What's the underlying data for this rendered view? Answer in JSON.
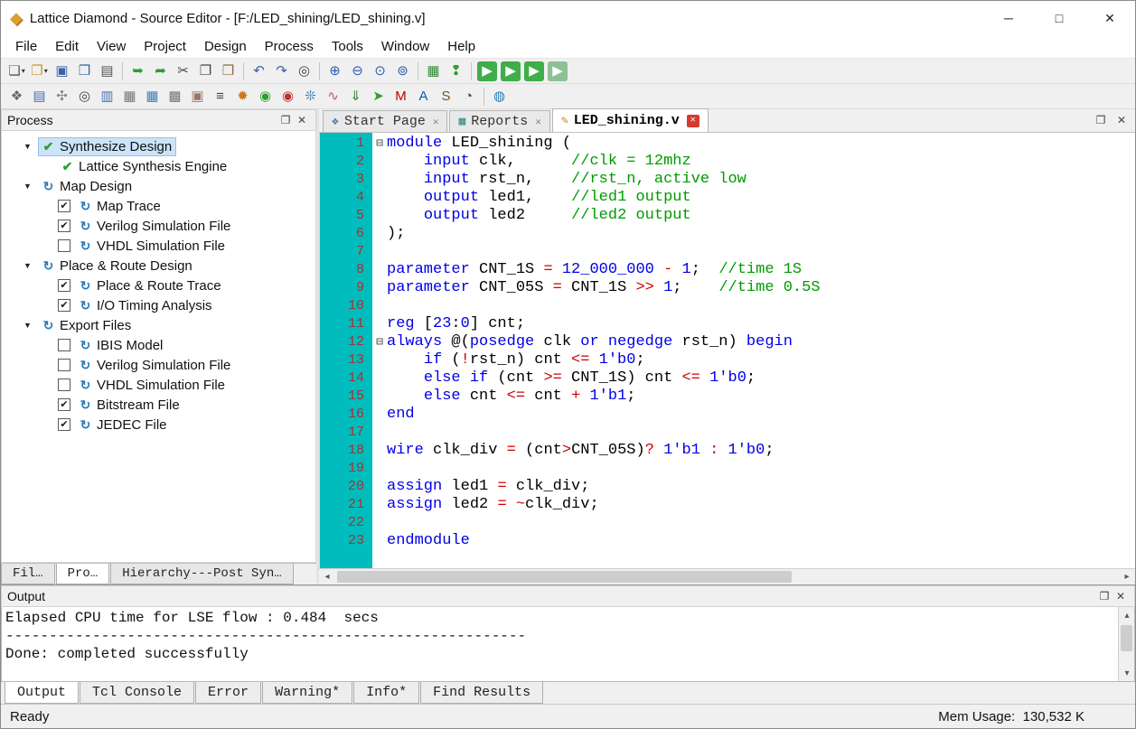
{
  "window": {
    "title": "Lattice Diamond - Source Editor - [F:/LED_shining/LED_shining.v]"
  },
  "icons": {
    "diamond": "◆",
    "minimize": "─",
    "maximize": "□",
    "close": "✕",
    "close_small": "✕",
    "float": "❐",
    "caret": "▾",
    "expander": "▼",
    "check": "✔",
    "check_green": "✔",
    "sync": "↻",
    "fold": "⊟",
    "arrow_left": "◂",
    "arrow_right": "▸",
    "arrow_up": "▴",
    "arrow_down": "▾",
    "start_page": "❖",
    "reports": "▦",
    "source": "✎"
  },
  "menu": {
    "items": [
      "File",
      "Edit",
      "View",
      "Project",
      "Design",
      "Process",
      "Tools",
      "Window",
      "Help"
    ]
  },
  "toolbar1": [
    {
      "name": "new-file",
      "glyph": "❏",
      "color": "#555555",
      "dropdown": true
    },
    {
      "name": "open-file",
      "glyph": "❐",
      "color": "#c8972c",
      "dropdown": true
    },
    {
      "name": "save",
      "glyph": "▣",
      "color": "#3a62a8"
    },
    {
      "name": "save-all",
      "glyph": "❒",
      "color": "#3a62a8"
    },
    {
      "name": "print",
      "glyph": "▤",
      "color": "#555555"
    },
    {
      "sep": true
    },
    {
      "name": "check-out",
      "glyph": "➥",
      "color": "#2f9e2f"
    },
    {
      "name": "check-in",
      "glyph": "➦",
      "color": "#2f9e2f"
    },
    {
      "name": "cut",
      "glyph": "✂",
      "color": "#444444"
    },
    {
      "name": "copy",
      "glyph": "❐",
      "color": "#444444"
    },
    {
      "name": "paste",
      "glyph": "❒",
      "color": "#8a6d3b"
    },
    {
      "sep": true
    },
    {
      "name": "undo",
      "glyph": "↶",
      "color": "#3a62a8"
    },
    {
      "name": "redo",
      "glyph": "↷",
      "color": "#3a62a8"
    },
    {
      "name": "find",
      "glyph": "◎",
      "color": "#444444"
    },
    {
      "sep": true
    },
    {
      "name": "zoom-in",
      "glyph": "⊕",
      "color": "#2a5db0"
    },
    {
      "name": "zoom-out",
      "glyph": "⊖",
      "color": "#2a5db0"
    },
    {
      "name": "zoom-fit",
      "glyph": "⊙",
      "color": "#2a5db0"
    },
    {
      "name": "zoom-selection",
      "glyph": "⊚",
      "color": "#2a5db0"
    },
    {
      "sep": true
    },
    {
      "name": "html-report",
      "glyph": "▦",
      "color": "#3a8a3a"
    },
    {
      "name": "message-console",
      "glyph": "❢",
      "color": "#2f9e2f"
    },
    {
      "sep": true
    },
    {
      "name": "run-synthesis",
      "glyph": "▶",
      "bg": "#3fae49"
    },
    {
      "name": "run-map",
      "glyph": "▶",
      "bg": "#3fae49"
    },
    {
      "name": "run-par",
      "glyph": "▶",
      "bg": "#3fae49"
    },
    {
      "name": "run-export",
      "glyph": "▶",
      "bg": "#8fbf94"
    }
  ],
  "toolbar2": [
    {
      "name": "new-project",
      "glyph": "❖",
      "color": "#666666"
    },
    {
      "name": "file-list",
      "glyph": "▤",
      "color": "#4a6fb5"
    },
    {
      "name": "process-flow",
      "glyph": "✣",
      "color": "#888888"
    },
    {
      "name": "find-in-files",
      "glyph": "◎",
      "color": "#444444"
    },
    {
      "name": "console",
      "glyph": "▥",
      "color": "#4a6fb5"
    },
    {
      "name": "message-window",
      "glyph": "▦",
      "color": "#777777"
    },
    {
      "name": "spreadsheet-view",
      "glyph": "▦",
      "color": "#3f7fbf"
    },
    {
      "name": "package-view",
      "glyph": "▩",
      "color": "#777777"
    },
    {
      "name": "device-view",
      "glyph": "▣",
      "color": "#997766"
    },
    {
      "name": "netlist-view",
      "glyph": "≡",
      "color": "#444444"
    },
    {
      "name": "ipexpress",
      "glyph": "✹",
      "color": "#c87820"
    },
    {
      "name": "reveal-inserter",
      "glyph": "◉",
      "color": "#2f9e2f"
    },
    {
      "name": "reveal-analyzer",
      "glyph": "◉",
      "color": "#c03030"
    },
    {
      "name": "clarity-designer",
      "glyph": "❊",
      "color": "#3f7fbf"
    },
    {
      "name": "power-calculator",
      "glyph": "∿",
      "color": "#b05090"
    },
    {
      "name": "programmer",
      "glyph": "⇓",
      "color": "#2f7f2f"
    },
    {
      "name": "run-manager",
      "glyph": "➤",
      "color": "#2f9e2f"
    },
    {
      "name": "modelsim",
      "glyph": "M",
      "color": "#c00000"
    },
    {
      "name": "active-hdl",
      "glyph": "A",
      "color": "#0060c0"
    },
    {
      "name": "synplify",
      "glyph": "S",
      "color": "#805020"
    },
    {
      "name": "timing-analyzer",
      "glyph": "◔",
      "color": "#444444"
    },
    {
      "sep": true
    },
    {
      "name": "help-globe",
      "glyph": "◍",
      "color": "#2a7ab5"
    }
  ],
  "process_panel": {
    "title": "Process",
    "tree": [
      {
        "level": 0,
        "expander": true,
        "icon": "check_green",
        "label": "Synthesize Design",
        "selected": true
      },
      {
        "level": 1,
        "icon": "check_green",
        "label": "Lattice Synthesis Engine"
      },
      {
        "level": 0,
        "expander": true,
        "icon": "sync",
        "label": "Map Design"
      },
      {
        "level": 1,
        "checkbox": "checked",
        "icon": "sync",
        "label": "Map Trace"
      },
      {
        "level": 1,
        "checkbox": "checked",
        "icon": "sync",
        "label": "Verilog Simulation File"
      },
      {
        "level": 1,
        "checkbox": "unchecked",
        "icon": "sync",
        "label": "VHDL Simulation File"
      },
      {
        "level": 0,
        "expander": true,
        "icon": "sync",
        "label": "Place & Route Design"
      },
      {
        "level": 1,
        "checkbox": "checked",
        "icon": "sync",
        "label": "Place & Route Trace"
      },
      {
        "level": 1,
        "checkbox": "checked",
        "icon": "sync",
        "label": "I/O Timing Analysis"
      },
      {
        "level": 0,
        "expander": true,
        "icon": "sync",
        "label": "Export Files"
      },
      {
        "level": 1,
        "checkbox": "unchecked",
        "icon": "sync",
        "label": "IBIS Model"
      },
      {
        "level": 1,
        "checkbox": "unchecked",
        "icon": "sync",
        "label": "Verilog Simulation File"
      },
      {
        "level": 1,
        "checkbox": "unchecked",
        "icon": "sync",
        "label": "VHDL Simulation File"
      },
      {
        "level": 1,
        "checkbox": "checked",
        "icon": "sync",
        "label": "Bitstream File"
      },
      {
        "level": 1,
        "checkbox": "checked",
        "icon": "sync",
        "label": "JEDEC File"
      }
    ],
    "tabs": [
      {
        "label": "Fil…",
        "active": false
      },
      {
        "label": "Pro…",
        "active": true
      },
      {
        "label": "Hierarchy---Post Syn…",
        "active": false
      }
    ]
  },
  "editor": {
    "tabs": [
      {
        "id": "start-page",
        "label": "Start Page",
        "icon": "start_page",
        "icon_color": "#4a7ab5",
        "close": "gray",
        "active": false
      },
      {
        "id": "reports",
        "label": "Reports",
        "icon": "reports",
        "icon_color": "#3a8a8a",
        "close": "gray",
        "active": false
      },
      {
        "id": "led-shining-v",
        "label": "LED_shining.v",
        "icon": "source",
        "icon_color": "#b8860b",
        "close": "red",
        "active": true
      }
    ],
    "code": [
      {
        "n": 1,
        "fold": true,
        "seg": [
          [
            "k",
            "module"
          ],
          [
            "p",
            " LED_shining ("
          ]
        ]
      },
      {
        "n": 2,
        "seg": [
          [
            "p",
            "    "
          ],
          [
            "k",
            "input"
          ],
          [
            "p",
            " clk,      "
          ],
          [
            "c",
            "//clk = 12mhz"
          ]
        ]
      },
      {
        "n": 3,
        "seg": [
          [
            "p",
            "    "
          ],
          [
            "k",
            "input"
          ],
          [
            "p",
            " rst_n,    "
          ],
          [
            "c",
            "//rst_n, active low"
          ]
        ]
      },
      {
        "n": 4,
        "seg": [
          [
            "p",
            "    "
          ],
          [
            "k",
            "output"
          ],
          [
            "p",
            " led1,    "
          ],
          [
            "c",
            "//led1 output"
          ]
        ]
      },
      {
        "n": 5,
        "seg": [
          [
            "p",
            "    "
          ],
          [
            "k",
            "output"
          ],
          [
            "p",
            " led2     "
          ],
          [
            "c",
            "//led2 output"
          ]
        ]
      },
      {
        "n": 6,
        "seg": [
          [
            "p",
            ");"
          ]
        ]
      },
      {
        "n": 7,
        "seg": []
      },
      {
        "n": 8,
        "seg": [
          [
            "k",
            "parameter"
          ],
          [
            "p",
            " CNT_1S "
          ],
          [
            "o",
            "="
          ],
          [
            "p",
            " "
          ],
          [
            "n",
            "12_000_000"
          ],
          [
            "p",
            " "
          ],
          [
            "o",
            "-"
          ],
          [
            "p",
            " "
          ],
          [
            "n",
            "1"
          ],
          [
            "p",
            ";  "
          ],
          [
            "c",
            "//time 1S"
          ]
        ]
      },
      {
        "n": 9,
        "seg": [
          [
            "k",
            "parameter"
          ],
          [
            "p",
            " CNT_05S "
          ],
          [
            "o",
            "="
          ],
          [
            "p",
            " CNT_1S "
          ],
          [
            "o",
            ">>"
          ],
          [
            "p",
            " "
          ],
          [
            "n",
            "1"
          ],
          [
            "p",
            ";    "
          ],
          [
            "c",
            "//time 0.5S"
          ]
        ]
      },
      {
        "n": 10,
        "seg": []
      },
      {
        "n": 11,
        "seg": [
          [
            "k",
            "reg"
          ],
          [
            "p",
            " ["
          ],
          [
            "n",
            "23"
          ],
          [
            "p",
            ":"
          ],
          [
            "n",
            "0"
          ],
          [
            "p",
            "] cnt;"
          ]
        ]
      },
      {
        "n": 12,
        "fold": true,
        "seg": [
          [
            "k",
            "always"
          ],
          [
            "p",
            " @("
          ],
          [
            "k",
            "posedge"
          ],
          [
            "p",
            " clk "
          ],
          [
            "k",
            "or"
          ],
          [
            "p",
            " "
          ],
          [
            "k",
            "negedge"
          ],
          [
            "p",
            " rst_n) "
          ],
          [
            "k",
            "begin"
          ]
        ]
      },
      {
        "n": 13,
        "seg": [
          [
            "p",
            "    "
          ],
          [
            "k",
            "if"
          ],
          [
            "p",
            " ("
          ],
          [
            "o",
            "!"
          ],
          [
            "p",
            "rst_n) cnt "
          ],
          [
            "o",
            "<="
          ],
          [
            "p",
            " "
          ],
          [
            "n",
            "1'b0"
          ],
          [
            "p",
            ";"
          ]
        ]
      },
      {
        "n": 14,
        "seg": [
          [
            "p",
            "    "
          ],
          [
            "k",
            "else"
          ],
          [
            "p",
            " "
          ],
          [
            "k",
            "if"
          ],
          [
            "p",
            " (cnt "
          ],
          [
            "o",
            ">="
          ],
          [
            "p",
            " CNT_1S) cnt "
          ],
          [
            "o",
            "<="
          ],
          [
            "p",
            " "
          ],
          [
            "n",
            "1'b0"
          ],
          [
            "p",
            ";"
          ]
        ]
      },
      {
        "n": 15,
        "seg": [
          [
            "p",
            "    "
          ],
          [
            "k",
            "else"
          ],
          [
            "p",
            " cnt "
          ],
          [
            "o",
            "<="
          ],
          [
            "p",
            " cnt "
          ],
          [
            "o",
            "+"
          ],
          [
            "p",
            " "
          ],
          [
            "n",
            "1'b1"
          ],
          [
            "p",
            ";"
          ]
        ]
      },
      {
        "n": 16,
        "seg": [
          [
            "k",
            "end"
          ]
        ]
      },
      {
        "n": 17,
        "seg": []
      },
      {
        "n": 18,
        "seg": [
          [
            "k",
            "wire"
          ],
          [
            "p",
            " clk_div "
          ],
          [
            "o",
            "="
          ],
          [
            "p",
            " (cnt"
          ],
          [
            "o",
            ">"
          ],
          [
            "p",
            "CNT_05S)"
          ],
          [
            "o",
            "?"
          ],
          [
            "p",
            " "
          ],
          [
            "n",
            "1'b1"
          ],
          [
            "p",
            " "
          ],
          [
            "o",
            ":"
          ],
          [
            "p",
            " "
          ],
          [
            "n",
            "1'b0"
          ],
          [
            "p",
            ";"
          ]
        ]
      },
      {
        "n": 19,
        "seg": []
      },
      {
        "n": 20,
        "seg": [
          [
            "k",
            "assign"
          ],
          [
            "p",
            " led1 "
          ],
          [
            "o",
            "="
          ],
          [
            "p",
            " clk_div;"
          ]
        ]
      },
      {
        "n": 21,
        "seg": [
          [
            "k",
            "assign"
          ],
          [
            "p",
            " led2 "
          ],
          [
            "o",
            "="
          ],
          [
            "p",
            " "
          ],
          [
            "o",
            "~"
          ],
          [
            "p",
            "clk_div;"
          ]
        ]
      },
      {
        "n": 22,
        "seg": []
      },
      {
        "n": 23,
        "seg": [
          [
            "k",
            "endmodule"
          ]
        ]
      }
    ]
  },
  "output_panel": {
    "title": "Output",
    "lines": [
      "Elapsed CPU time for LSE flow : 0.484  secs",
      "------------------------------------------------------------",
      "Done: completed successfully"
    ],
    "tabs": [
      {
        "label": "Output",
        "active": true
      },
      {
        "label": "Tcl Console",
        "active": false
      },
      {
        "label": "Error",
        "active": false
      },
      {
        "label": "Warning*",
        "active": false
      },
      {
        "label": "Info*",
        "active": false
      },
      {
        "label": "Find Results",
        "active": false
      }
    ]
  },
  "statusbar": {
    "left": "Ready",
    "right": "Mem Usage:  130,532 K"
  }
}
